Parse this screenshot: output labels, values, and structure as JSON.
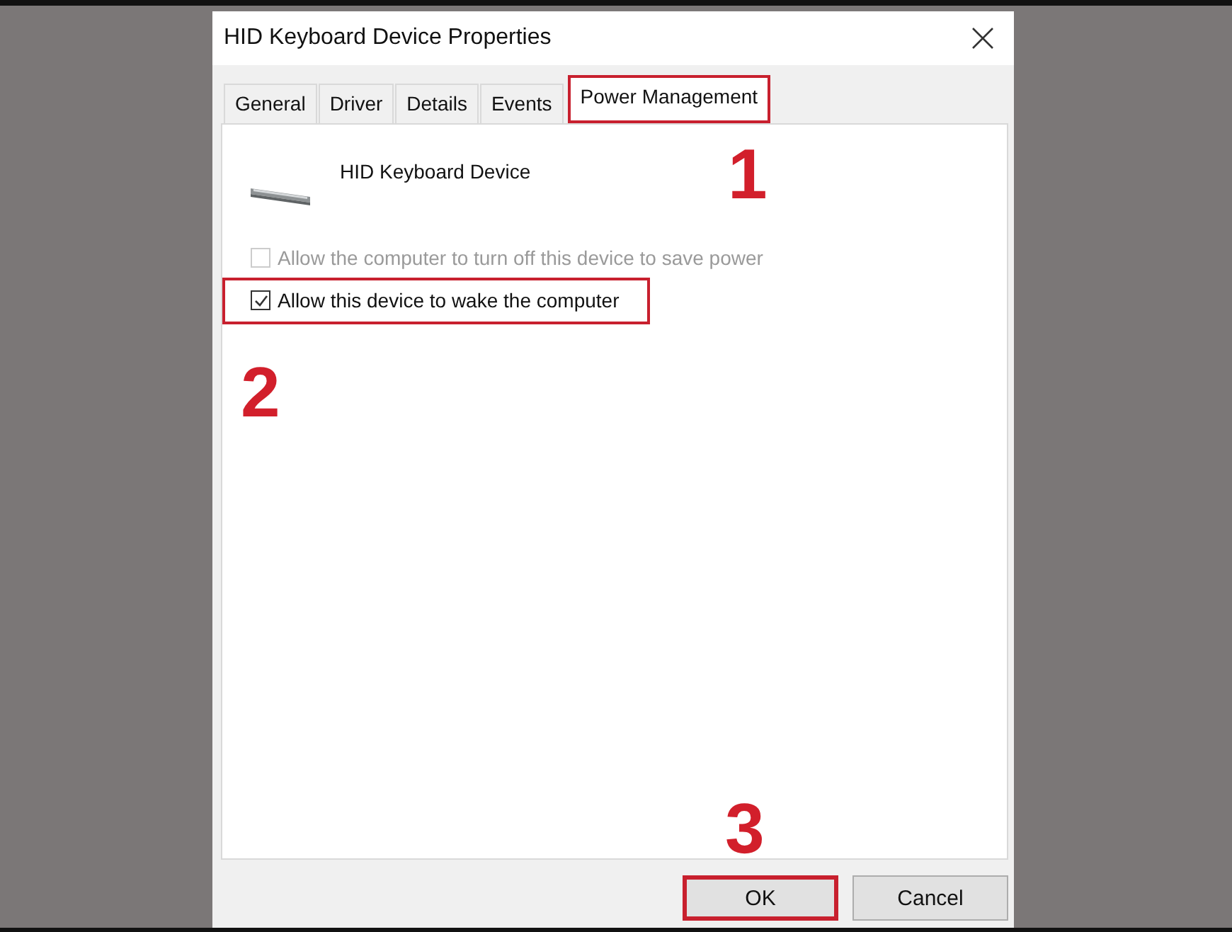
{
  "window": {
    "title": "HID Keyboard Device Properties"
  },
  "tabs": [
    {
      "label": "General",
      "selected": false,
      "highlighted": false
    },
    {
      "label": "Driver",
      "selected": false,
      "highlighted": false
    },
    {
      "label": "Details",
      "selected": false,
      "highlighted": false
    },
    {
      "label": "Events",
      "selected": false,
      "highlighted": false
    },
    {
      "label": "Power Management",
      "selected": true,
      "highlighted": true
    }
  ],
  "device": {
    "name": "HID Keyboard Device"
  },
  "options": [
    {
      "label": "Allow the computer to turn off this device to save power",
      "checked": false,
      "disabled": true,
      "highlighted": false
    },
    {
      "label": "Allow this device to wake the computer",
      "checked": true,
      "disabled": false,
      "highlighted": true
    }
  ],
  "buttons": [
    {
      "label": "OK",
      "highlighted": true
    },
    {
      "label": "Cancel",
      "highlighted": false
    }
  ],
  "step_numbers": [
    {
      "number": "1",
      "kind": "tab"
    },
    {
      "number": "2",
      "kind": "option"
    },
    {
      "number": "3",
      "kind": "button"
    }
  ]
}
